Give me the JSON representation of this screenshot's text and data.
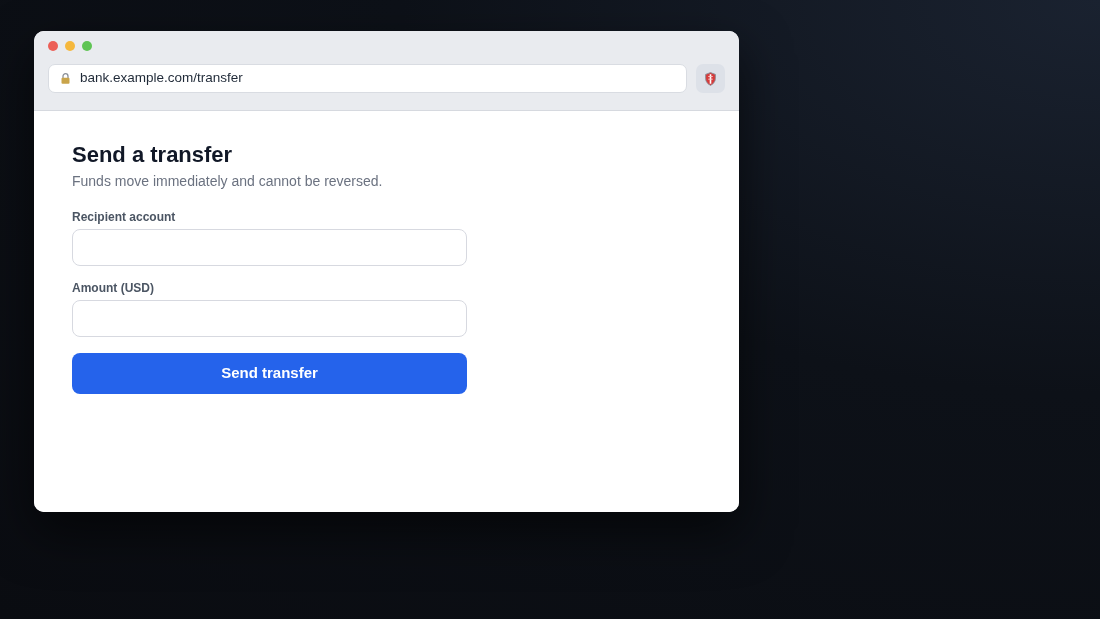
{
  "address_bar": {
    "url": "bank.example.com/transfer"
  },
  "page": {
    "title": "Send a transfer",
    "subtitle": "Funds move immediately and cannot be reversed.",
    "fields": [
      {
        "label": "Recipient account"
      },
      {
        "label": "Amount (USD)"
      }
    ],
    "submit_button": "Send transfer"
  }
}
